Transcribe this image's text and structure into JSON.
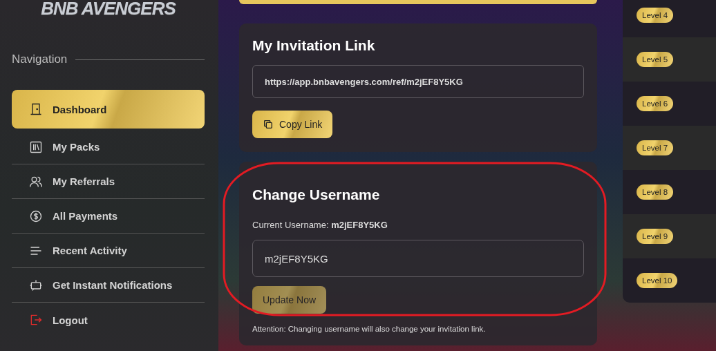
{
  "sidebar": {
    "logo": "BNB AVENGERS",
    "heading": "Navigation",
    "items": [
      {
        "label": "Dashboard",
        "selected": true
      },
      {
        "label": "My Packs",
        "selected": false
      },
      {
        "label": "My Referrals",
        "selected": false
      },
      {
        "label": "All Payments",
        "selected": false
      },
      {
        "label": "Recent Activity",
        "selected": false
      },
      {
        "label": "Get Instant Notifications",
        "selected": false
      },
      {
        "label": "Logout",
        "selected": false
      }
    ]
  },
  "invitation": {
    "title": "My Invitation Link",
    "link": "https://app.bnbavengers.com/ref/m2jEF8Y5KG",
    "button": "Copy Link"
  },
  "change_username": {
    "title": "Change Username",
    "current_label": "Current Username: **m2jEF8Y5KG**",
    "value": "m2jEF8Y5KG",
    "button": "Update Now",
    "button_disabled": true,
    "note": "Attention: Changing username will also change your invitation link.",
    "highlighted": true
  },
  "levels": [
    "Level 4",
    "Level 5",
    "Level 6",
    "Level 7",
    "Level 8",
    "Level 9",
    "Level 10"
  ]
}
